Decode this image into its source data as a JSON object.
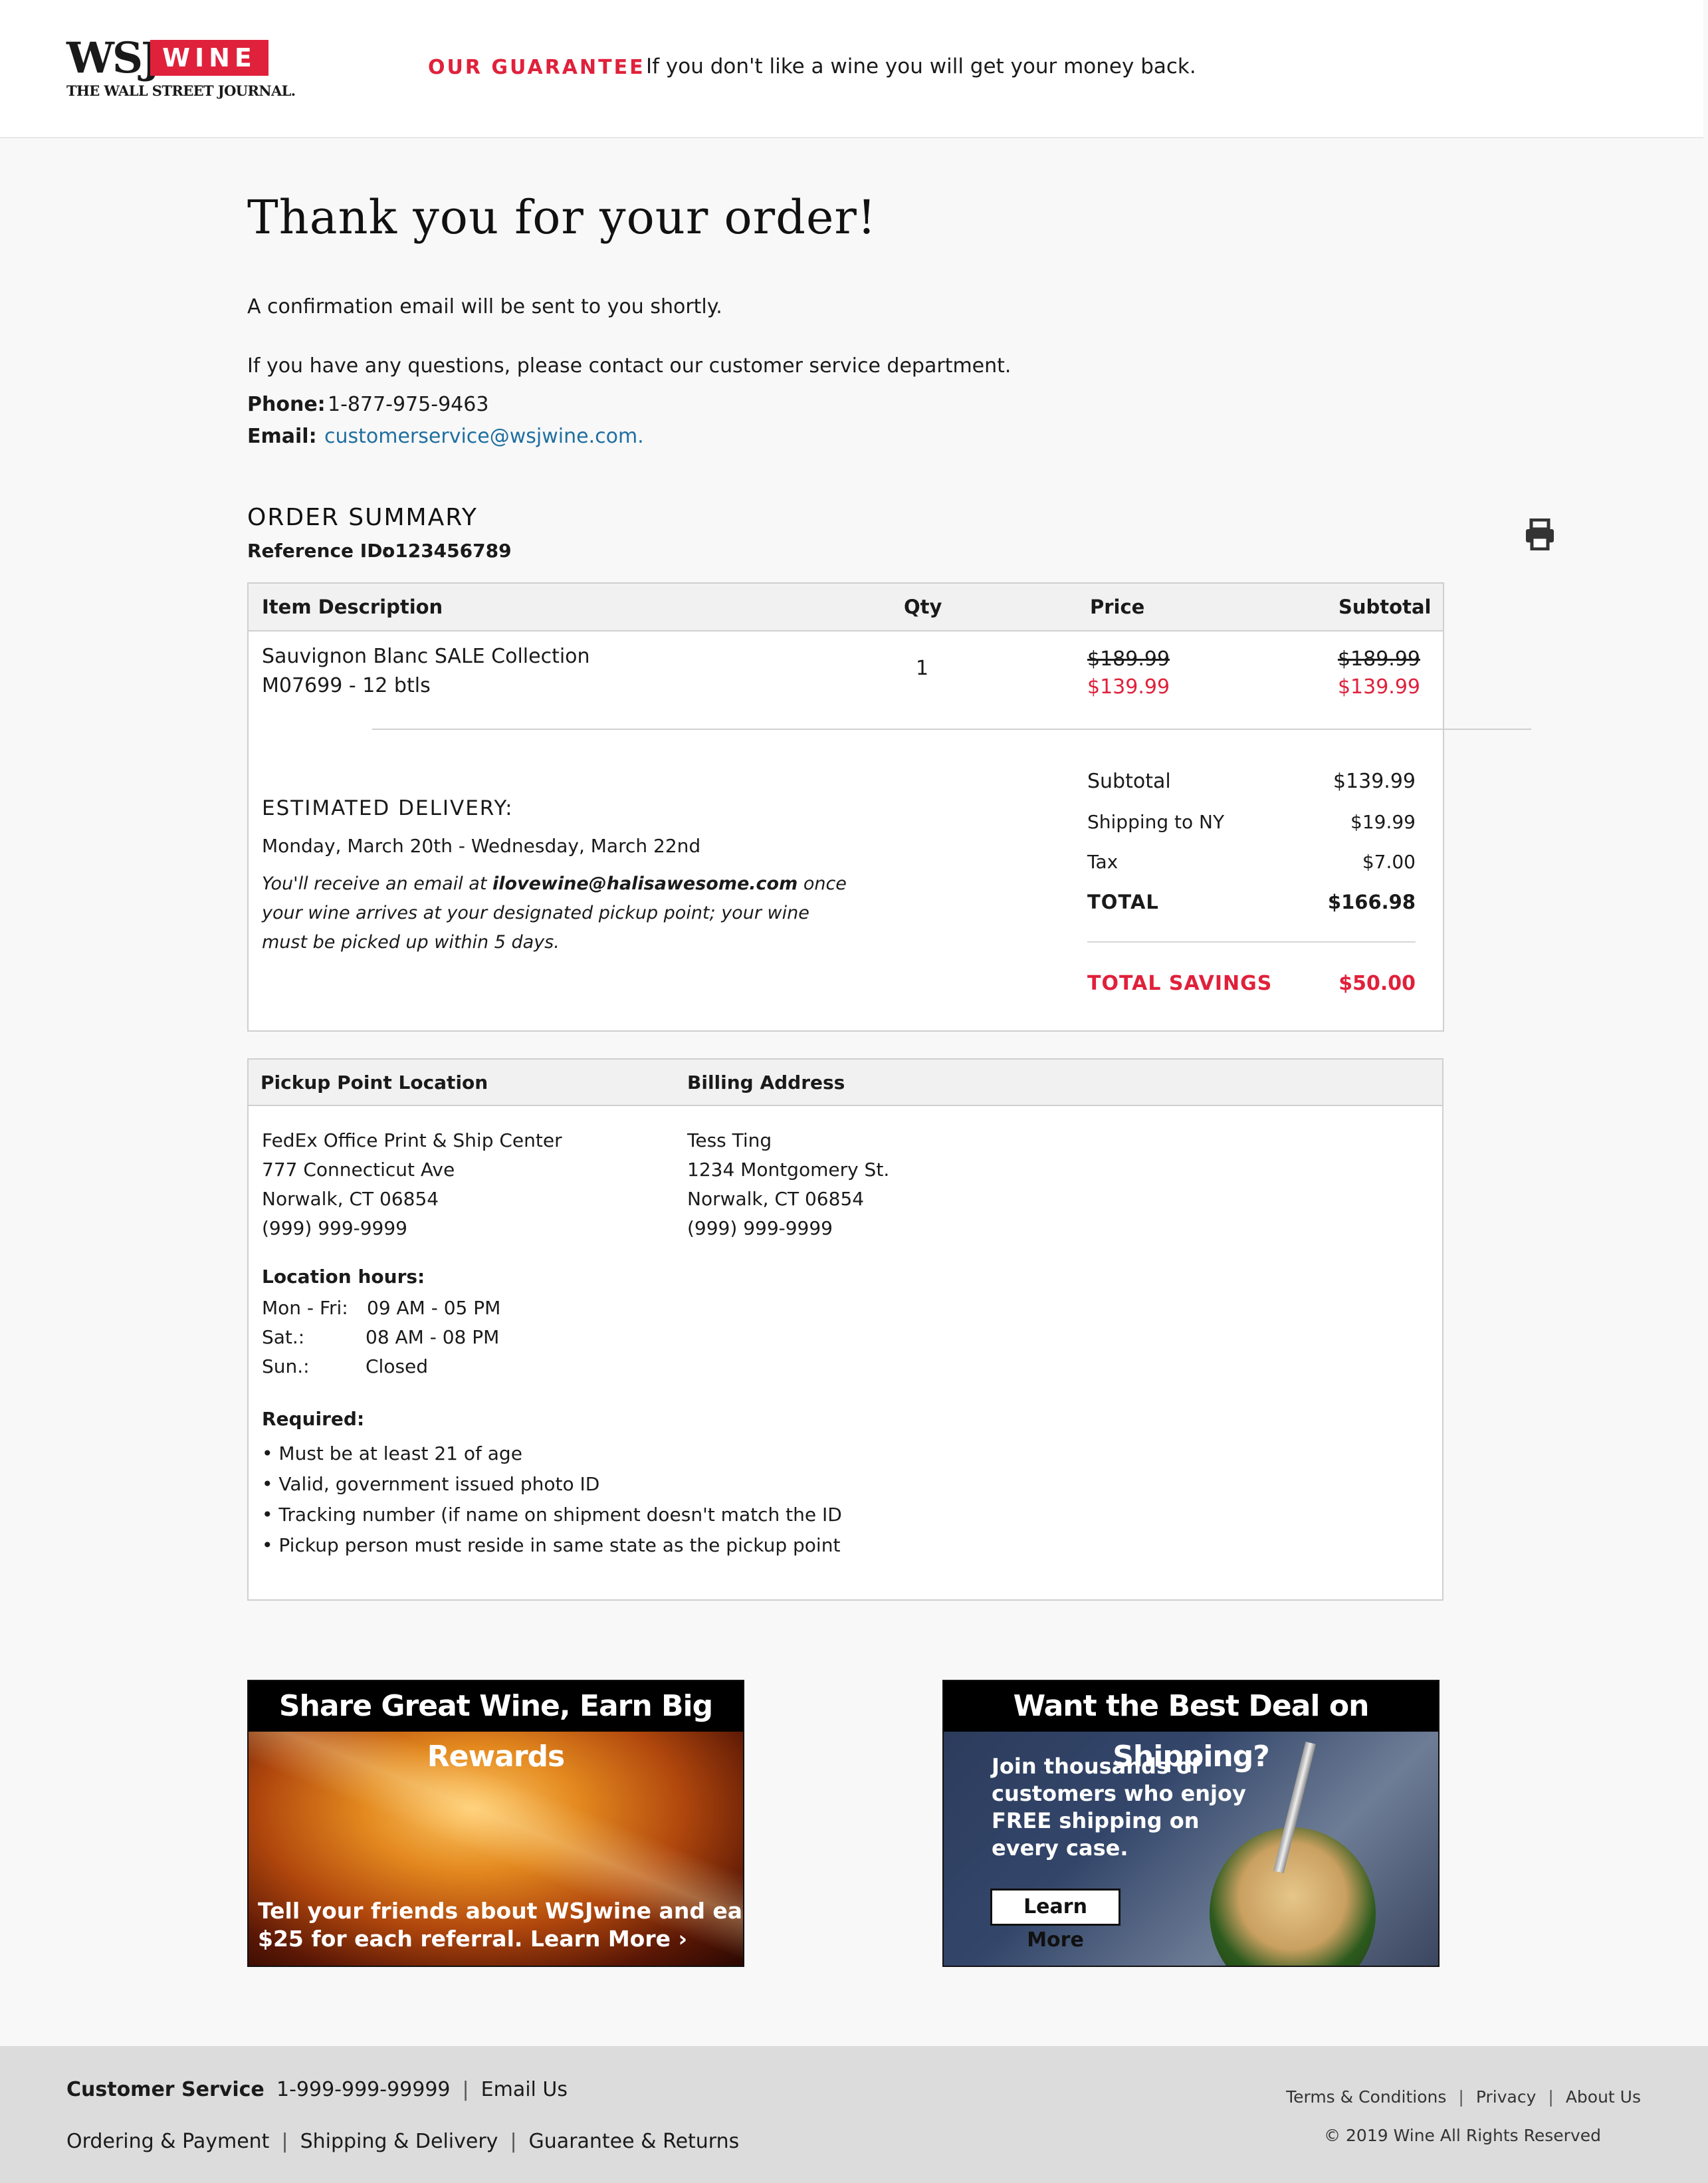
{
  "header": {
    "logo": {
      "wsj": "WSJ",
      "wine": "WINE",
      "tagline": "THE WALL STREET JOURNAL."
    },
    "guarantee_label": "OUR GUARANTEE",
    "guarantee_text": "If you don't like a wine you will get your money back."
  },
  "confirmation": {
    "title": "Thank you for your order!",
    "email_notice": "A confirmation email will be sent to you shortly.",
    "questions_text": "If you have any questions, please contact our customer service department.",
    "phone_label": "Phone:",
    "phone": "1-877-975-9463",
    "email_label": "Email:",
    "email": "customerservice@wsjwine.com."
  },
  "order_summary": {
    "title": "ORDER SUMMARY",
    "reference_label": "Reference ID:",
    "reference_id": "o123456789",
    "print_icon": "printer-icon",
    "columns": [
      "Item Description",
      "Qty",
      "Price",
      "Subtotal"
    ],
    "items": [
      {
        "name": "Sauvignon Blanc SALE Collection",
        "sku": "M07699 - 12 btls",
        "qty": "1",
        "price_original": "$189.99",
        "price_sale": "$139.99",
        "subtotal_original": "$189.99",
        "subtotal_sale": "$139.99"
      }
    ],
    "delivery": {
      "title": "ESTIMATED DELIVERY:",
      "dates": "Monday, March 20th - Wednesday, March 22nd",
      "note_line1_pre": "You'll receive an email at ",
      "note_email": "ilovewine@halisawesome.com",
      "note_line1_post": " once",
      "note_line2": "your wine arrives at your designated pickup point; your wine",
      "note_line3": "must be picked up within 5 days."
    },
    "totals": {
      "subtotal_label": "Subtotal",
      "subtotal": "$139.99",
      "shipping_label": "Shipping to NY",
      "shipping": "$19.99",
      "tax_label": "Tax",
      "tax": "$7.00",
      "total_label": "TOTAL",
      "total": "$166.98",
      "savings_label": "TOTAL SAVINGS",
      "savings": "$50.00"
    }
  },
  "addresses": {
    "pickup_header": "Pickup Point Location",
    "billing_header": "Billing Address",
    "pickup": [
      "FedEx Office Print & Ship Center",
      "777 Connecticut Ave",
      "Norwalk, CT 06854",
      "(999) 999-9999"
    ],
    "billing": [
      "Tess Ting",
      "1234 Montgomery St.",
      "Norwalk, CT 06854",
      "(999) 999-9999"
    ],
    "hours_title": "Location hours:",
    "hours": [
      {
        "day": "Mon - Fri:",
        "time": "09 AM - 05 PM"
      },
      {
        "day": "Sat.:",
        "time": "08 AM - 08 PM"
      },
      {
        "day": "Sun.:",
        "time": "Closed"
      }
    ],
    "required_title": "Required:",
    "required": [
      "• Must be at least 21 of age",
      "• Valid, government issued photo ID",
      "• Tracking number (if name on shipment doesn't match the ID",
      "• Pickup person must reside in same state as the pickup point"
    ]
  },
  "ads": {
    "referral": {
      "headline": "Share Great Wine, Earn Big Rewards",
      "text1": "Tell your friends about WSJwine and earn",
      "text2": "$25 for each referral. ",
      "cta": "Learn More ›"
    },
    "shipping": {
      "headline": "Want the Best Deal on Shipping?",
      "lines": [
        "Join thousands of",
        "customers who enjoy",
        "FREE shipping on",
        "every case."
      ],
      "cta": "Learn More"
    }
  },
  "footer": {
    "customer_service_label": "Customer Service",
    "phone": "1-999-999-99999",
    "email_link": "Email Us",
    "links": [
      "Ordering & Payment",
      "Shipping & Delivery",
      "Guarantee & Returns"
    ],
    "legal_links": [
      "Terms & Conditions",
      "Privacy",
      "About Us"
    ],
    "copyright": "2019 Wine All Rights Reserved"
  },
  "colors": {
    "brand_red": "#e0213b",
    "link_blue": "#1f6fa0"
  }
}
